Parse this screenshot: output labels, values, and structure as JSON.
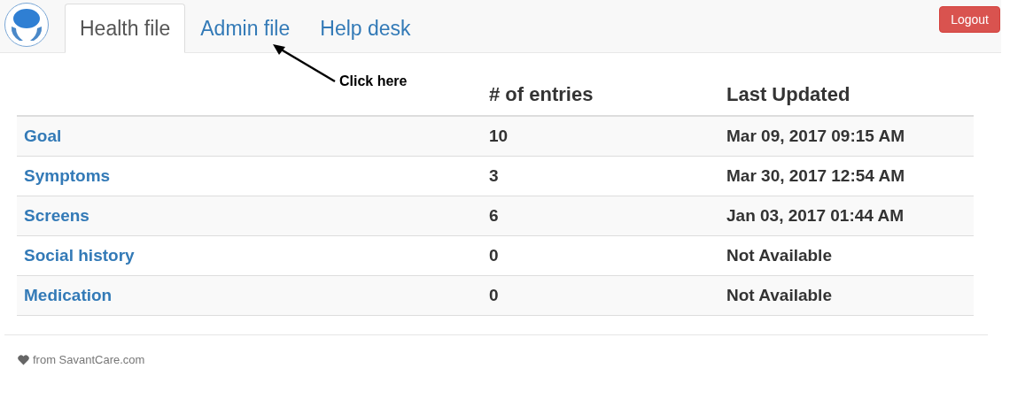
{
  "nav": {
    "tabs": [
      {
        "label": "Health file",
        "selected": true
      },
      {
        "label": "Admin file",
        "selected": false
      },
      {
        "label": "Help desk",
        "selected": false
      }
    ],
    "logout": "Logout"
  },
  "annotation": {
    "text": "Click here"
  },
  "table": {
    "columns": [
      "# of entries",
      "Last Updated"
    ],
    "rows": [
      {
        "name": "Goal",
        "entries": "10",
        "updated": "Mar 09, 2017 09:15 AM"
      },
      {
        "name": "Symptoms",
        "entries": "3",
        "updated": "Mar 30, 2017 12:54 AM"
      },
      {
        "name": "Screens",
        "entries": "6",
        "updated": "Jan 03, 2017 01:44 AM"
      },
      {
        "name": "Social history",
        "entries": "0",
        "updated": "Not Available"
      },
      {
        "name": "Medication",
        "entries": "0",
        "updated": "Not Available"
      }
    ]
  },
  "footer": {
    "text": "from SavantCare.com"
  }
}
